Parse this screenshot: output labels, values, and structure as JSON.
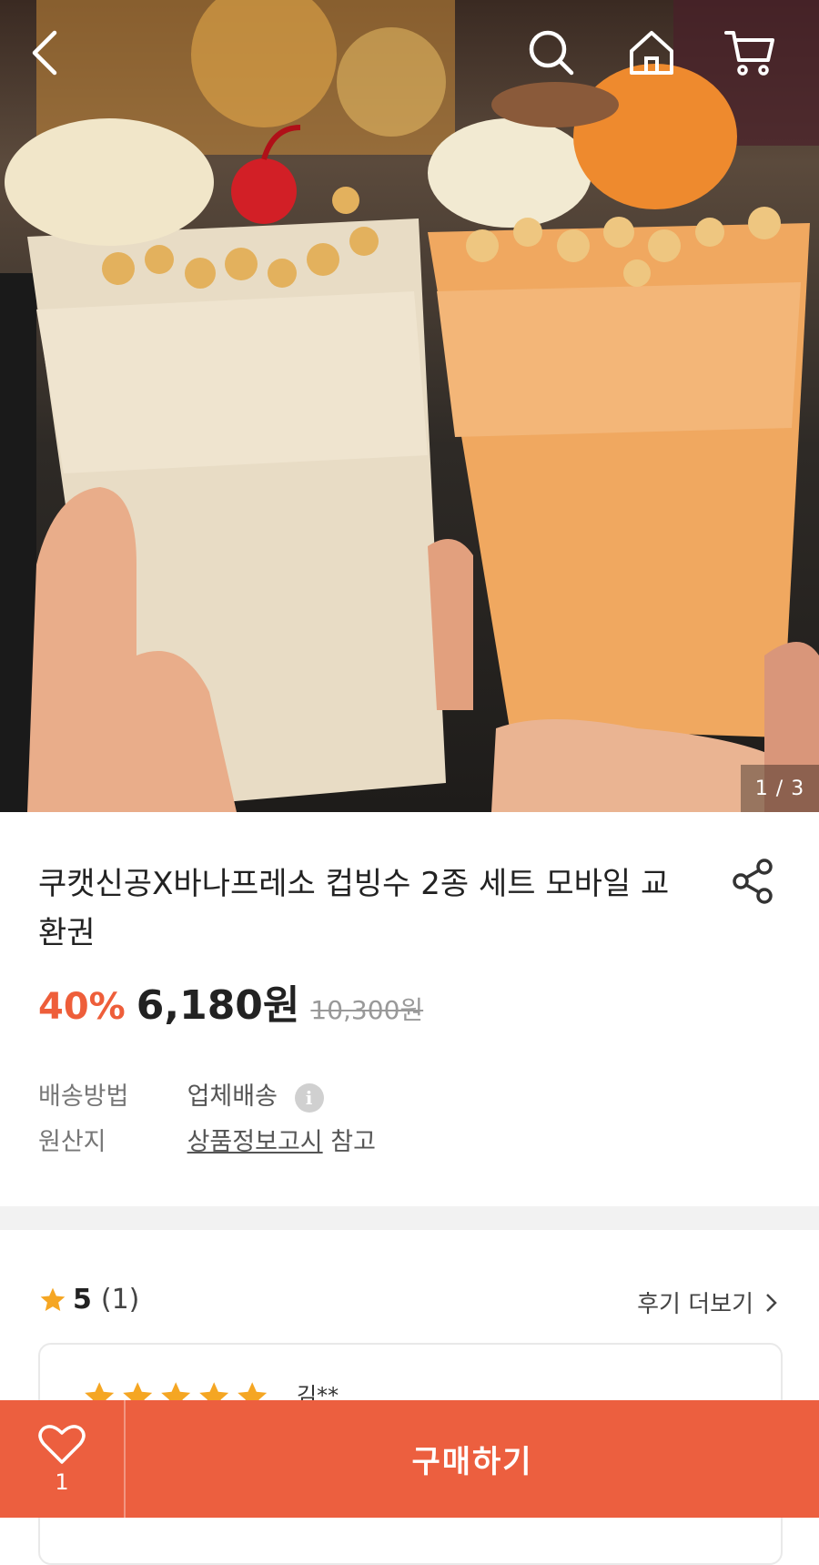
{
  "header": {
    "back_icon": "chevron-left-icon",
    "search_icon": "search-icon",
    "home_icon": "home-icon",
    "cart_icon": "cart-icon"
  },
  "gallery": {
    "counter": "1 / 3"
  },
  "product": {
    "title": "쿠캣신공X바나프레소 컵빙수 2종 세트 모바일 교환권",
    "discount": "40%",
    "price": "6,180원",
    "original_price": "10,300원"
  },
  "info": {
    "shipping_label": "배송방법",
    "shipping_value": "업체배송",
    "origin_label": "원산지",
    "origin_link": "상품정보고시",
    "origin_suffix": "참고"
  },
  "reviews": {
    "rating": "5",
    "count": "(1)",
    "more_label": "후기 더보기",
    "first_reviewer": "김**",
    "first_rating": 5
  },
  "bottom": {
    "like_count": "1",
    "buy_label": "구매하기"
  },
  "colors": {
    "accent": "#ec5f3f",
    "discount": "#ee5e3a",
    "star": "#f5a623"
  }
}
